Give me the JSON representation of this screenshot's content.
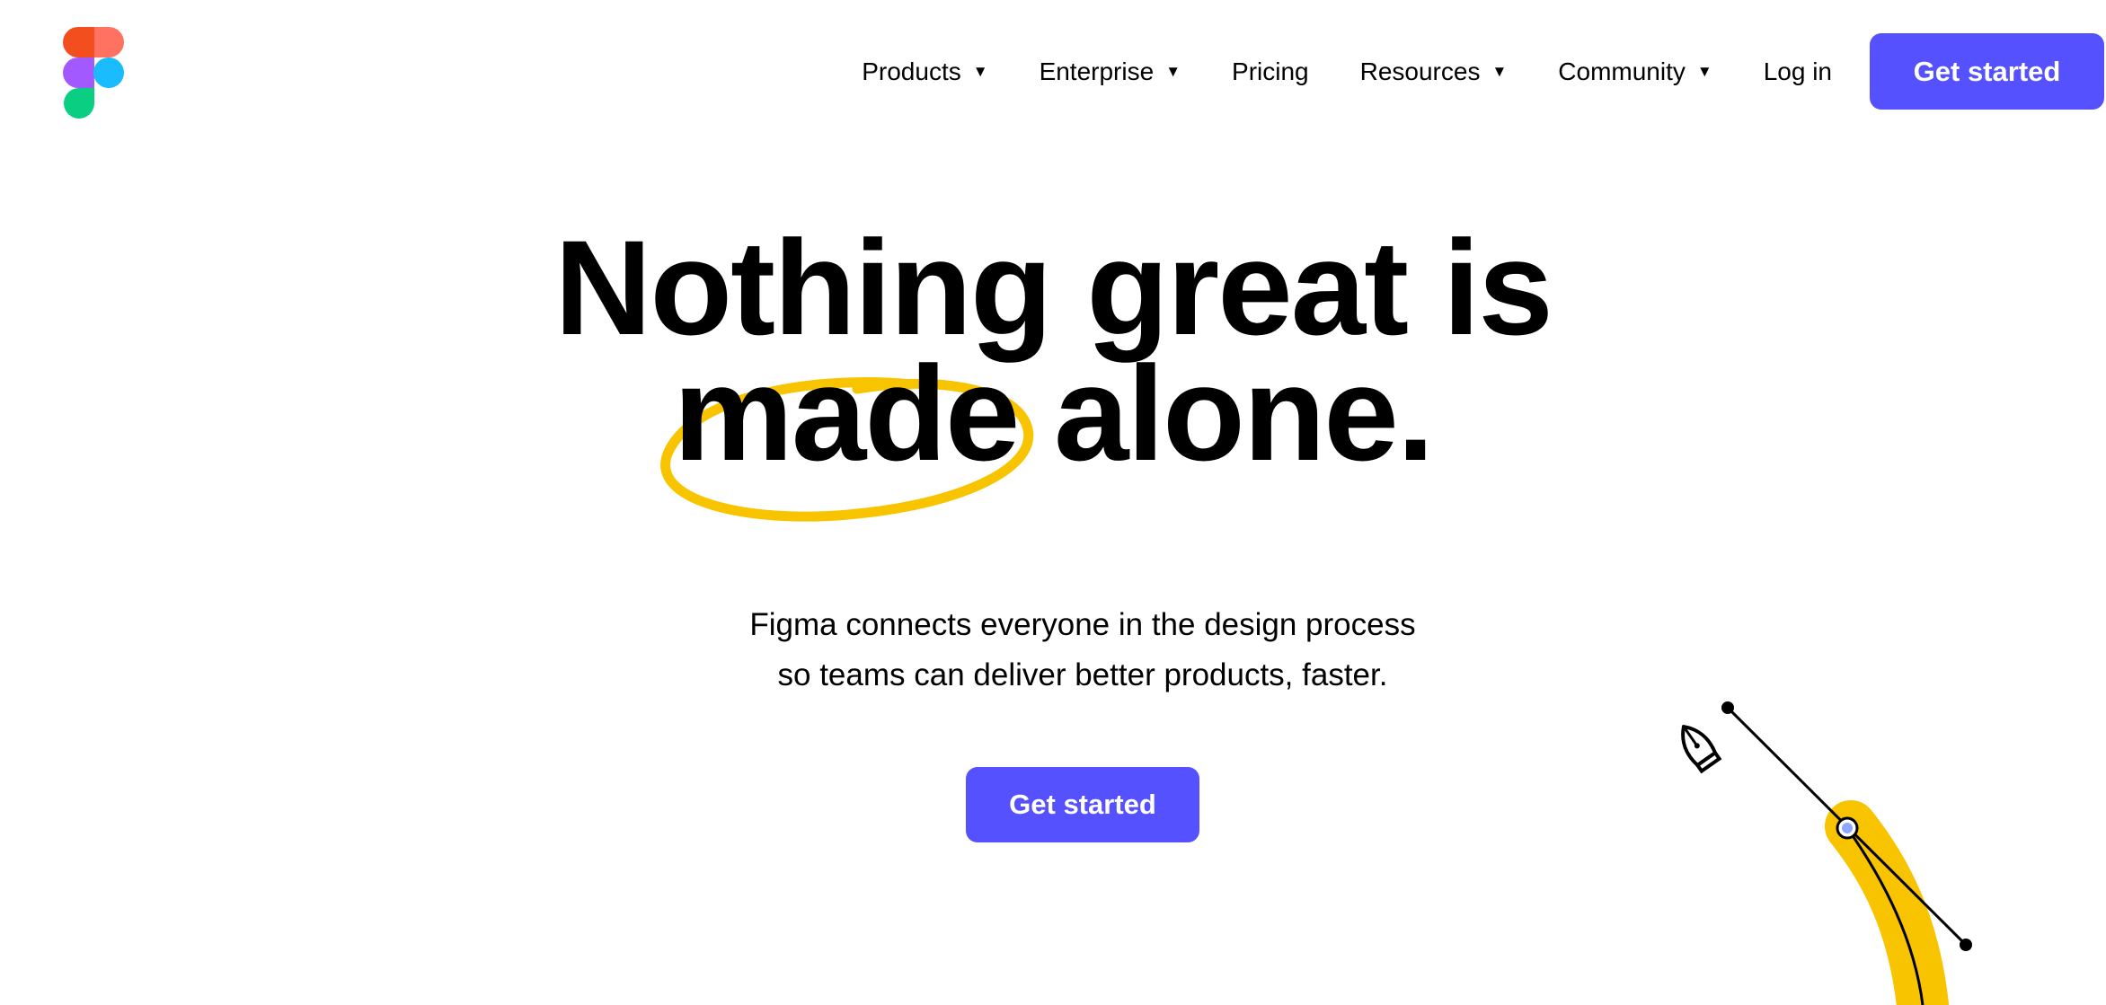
{
  "brand": {
    "logo_icon": "figma-logo-icon",
    "colors": {
      "red": "#f24e1e",
      "coral": "#ff7262",
      "purple": "#a259ff",
      "blue": "#1abcfe",
      "green": "#0acf83",
      "accent": "#5551ff",
      "highlight": "#f8c400"
    }
  },
  "nav": {
    "items": [
      {
        "label": "Products",
        "has_dropdown": true
      },
      {
        "label": "Enterprise",
        "has_dropdown": true
      },
      {
        "label": "Pricing",
        "has_dropdown": false
      },
      {
        "label": "Resources",
        "has_dropdown": true
      },
      {
        "label": "Community",
        "has_dropdown": true
      }
    ],
    "login_label": "Log in",
    "cta_label": "Get started",
    "dropdown_icon": "caret-down-icon"
  },
  "hero": {
    "headline_line1": "Nothing great is",
    "headline_highlight": "made",
    "headline_line2_rest": " alone.",
    "subhead_line1": "Figma connects everyone in the design process",
    "subhead_line2": "so teams can deliver better products, faster.",
    "cta_label": "Get started"
  },
  "decoration": {
    "pen_tool_icon": "pen-tool-icon"
  }
}
